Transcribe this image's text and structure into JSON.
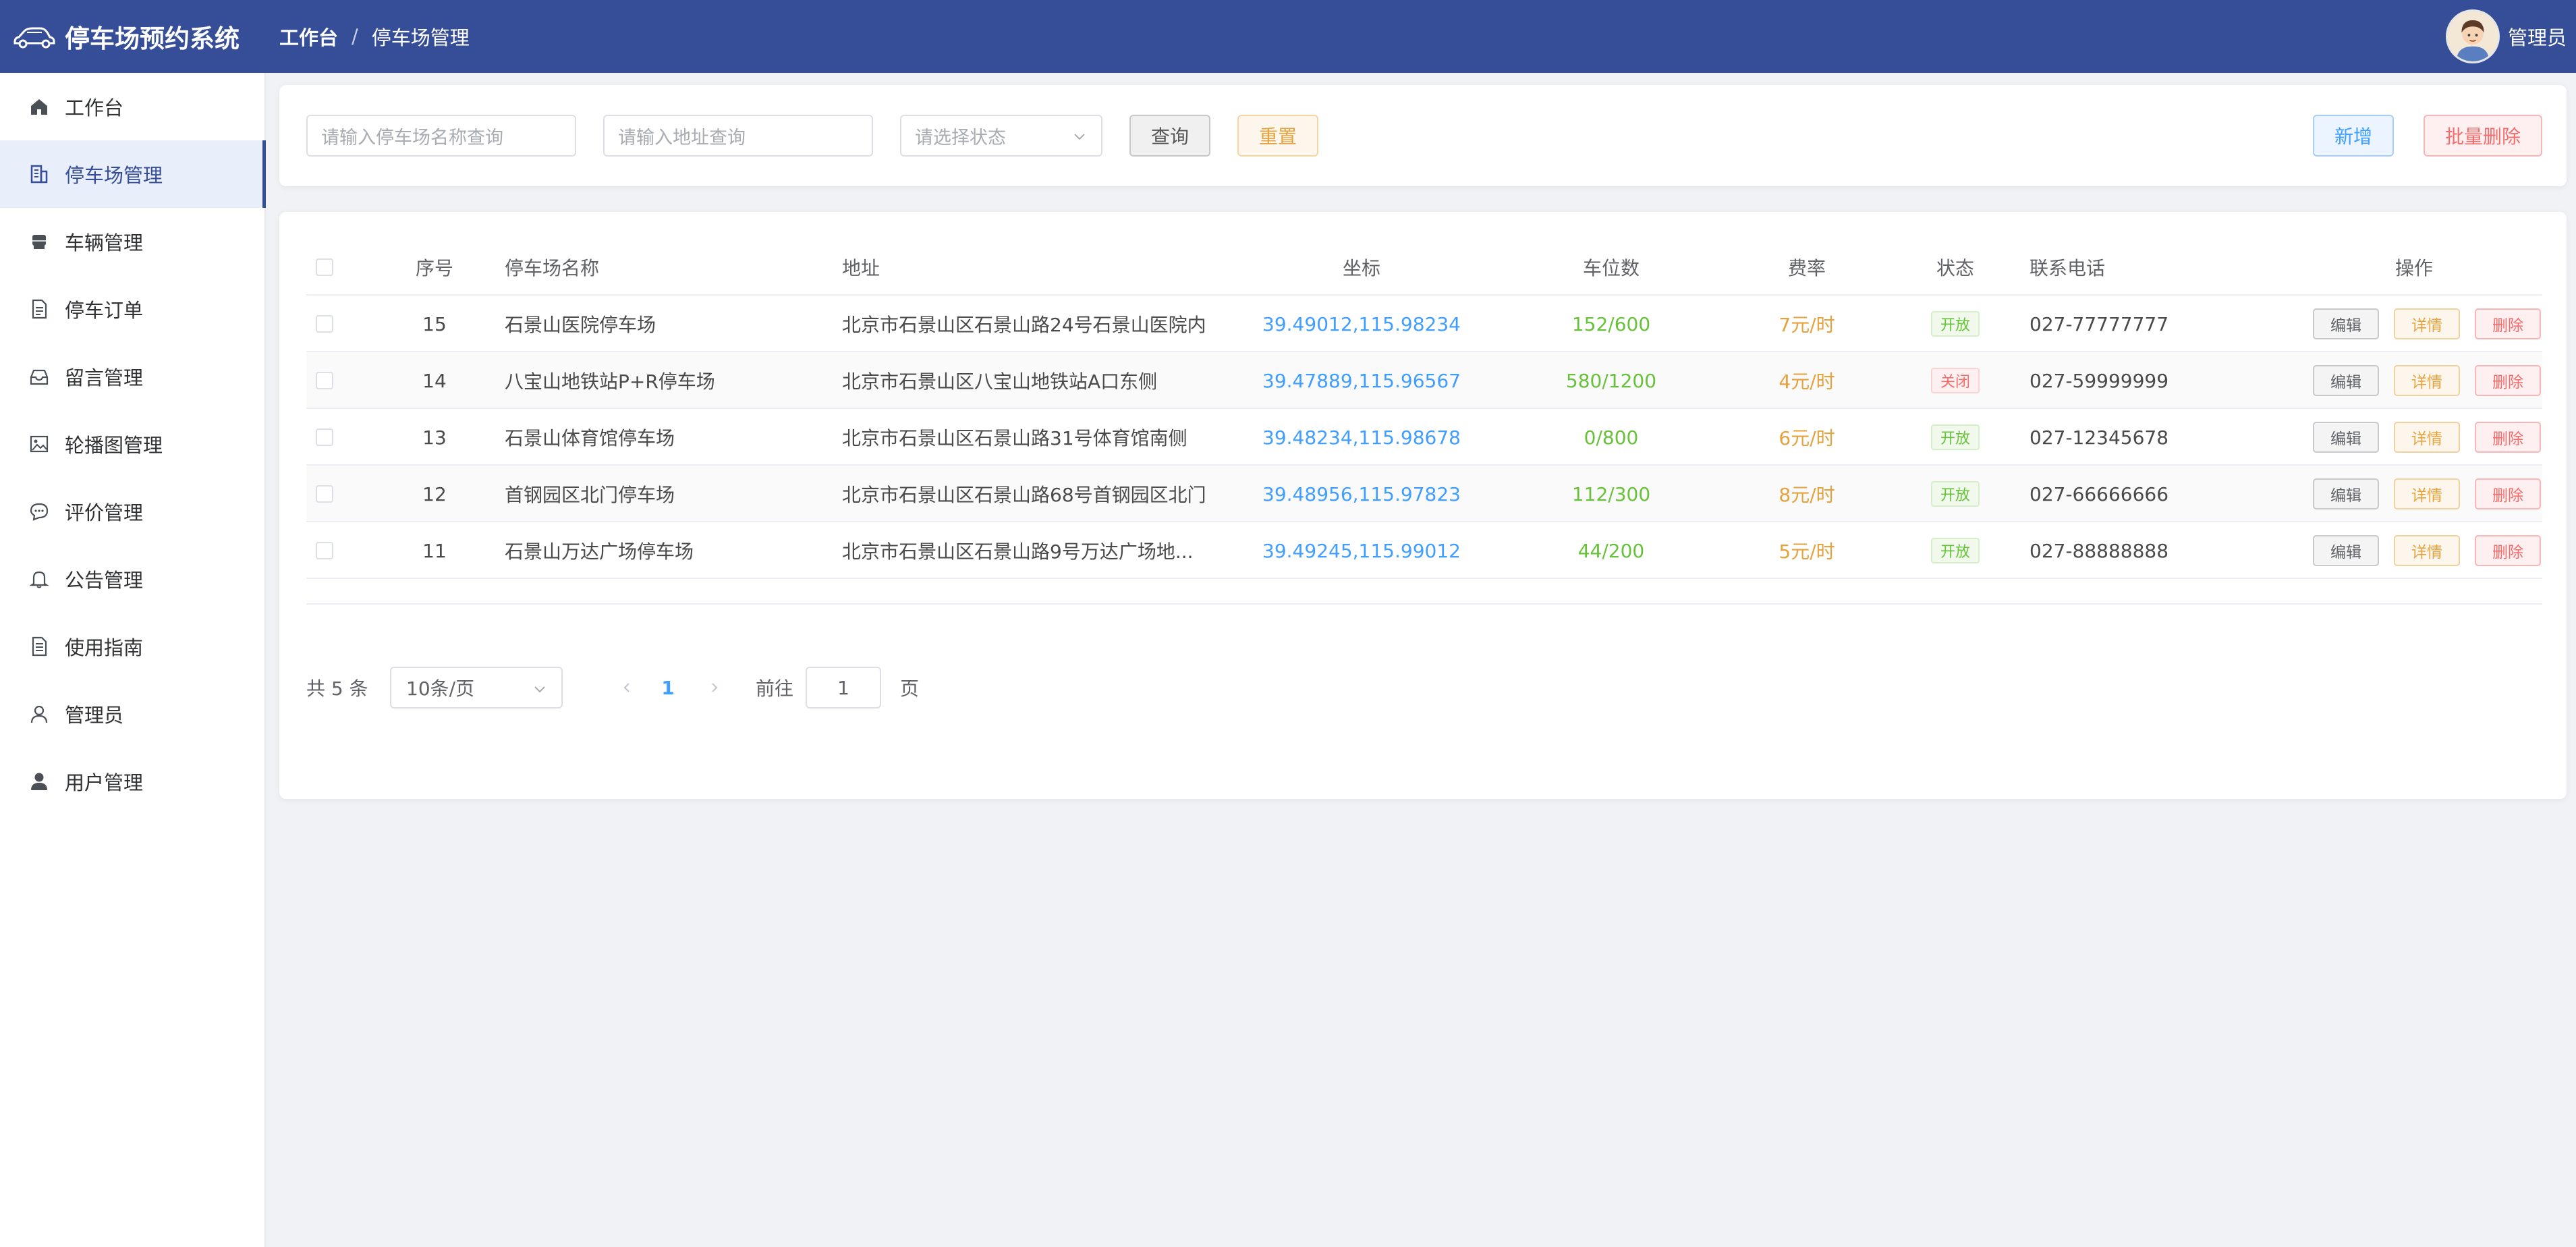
{
  "app": {
    "title": "停车场预约系统"
  },
  "breadcrumb": [
    "工作台",
    "停车场管理"
  ],
  "user": {
    "name": "管理员"
  },
  "sidebar": {
    "items": [
      {
        "label": "工作台",
        "icon": "home-icon"
      },
      {
        "label": "停车场管理",
        "icon": "building-icon",
        "active": true
      },
      {
        "label": "车辆管理",
        "icon": "car-icon"
      },
      {
        "label": "停车订单",
        "icon": "document-icon"
      },
      {
        "label": "留言管理",
        "icon": "inbox-icon"
      },
      {
        "label": "轮播图管理",
        "icon": "picture-icon"
      },
      {
        "label": "评价管理",
        "icon": "chat-icon"
      },
      {
        "label": "公告管理",
        "icon": "bell-icon"
      },
      {
        "label": "使用指南",
        "icon": "guide-icon"
      },
      {
        "label": "管理员",
        "icon": "user-icon"
      },
      {
        "label": "用户管理",
        "icon": "user-filled-icon"
      }
    ]
  },
  "search": {
    "name_placeholder": "请输入停车场名称查询",
    "address_placeholder": "请输入地址查询",
    "status_placeholder": "请选择状态",
    "query_label": "查询",
    "reset_label": "重置",
    "add_label": "新增",
    "batch_delete_label": "批量删除"
  },
  "table": {
    "headers": {
      "index": "序号",
      "name": "停车场名称",
      "address": "地址",
      "coord": "坐标",
      "spaces": "车位数",
      "rate": "费率",
      "status": "状态",
      "phone": "联系电话",
      "actions": "操作"
    },
    "action_labels": {
      "edit": "编辑",
      "detail": "详情",
      "delete": "删除"
    },
    "rows": [
      {
        "index": "15",
        "name": "石景山医院停车场",
        "address": "北京市石景山区石景山路24号石景山医院内",
        "coord": "39.49012,115.98234",
        "spaces": "152/600",
        "rate": "7元/时",
        "status": "开放",
        "phone": "027-77777777"
      },
      {
        "index": "14",
        "name": "八宝山地铁站P+R停车场",
        "address": "北京市石景山区八宝山地铁站A口东侧",
        "coord": "39.47889,115.96567",
        "spaces": "580/1200",
        "rate": "4元/时",
        "status": "关闭",
        "phone": "027-59999999"
      },
      {
        "index": "13",
        "name": "石景山体育馆停车场",
        "address": "北京市石景山区石景山路31号体育馆南侧",
        "coord": "39.48234,115.98678",
        "spaces": "0/800",
        "rate": "6元/时",
        "status": "开放",
        "phone": "027-12345678"
      },
      {
        "index": "12",
        "name": "首钢园区北门停车场",
        "address": "北京市石景山区石景山路68号首钢园区北门",
        "coord": "39.48956,115.97823",
        "spaces": "112/300",
        "rate": "8元/时",
        "status": "开放",
        "phone": "027-66666666"
      },
      {
        "index": "11",
        "name": "石景山万达广场停车场",
        "address": "北京市石景山区石景山路9号万达广场地...",
        "coord": "39.49245,115.99012",
        "spaces": "44/200",
        "rate": "5元/时",
        "status": "开放",
        "phone": "027-88888888"
      }
    ]
  },
  "pagination": {
    "total_text": "共 5 条",
    "page_size": "10条/页",
    "current_page": "1",
    "goto_label": "前往",
    "goto_value": "1",
    "page_suffix": "页"
  },
  "colors": {
    "header_bg": "#364d97",
    "accent_blue": "#409eff",
    "success_green": "#67c23a",
    "warning_orange": "#e6a23c",
    "danger_red": "#f56c6c"
  }
}
